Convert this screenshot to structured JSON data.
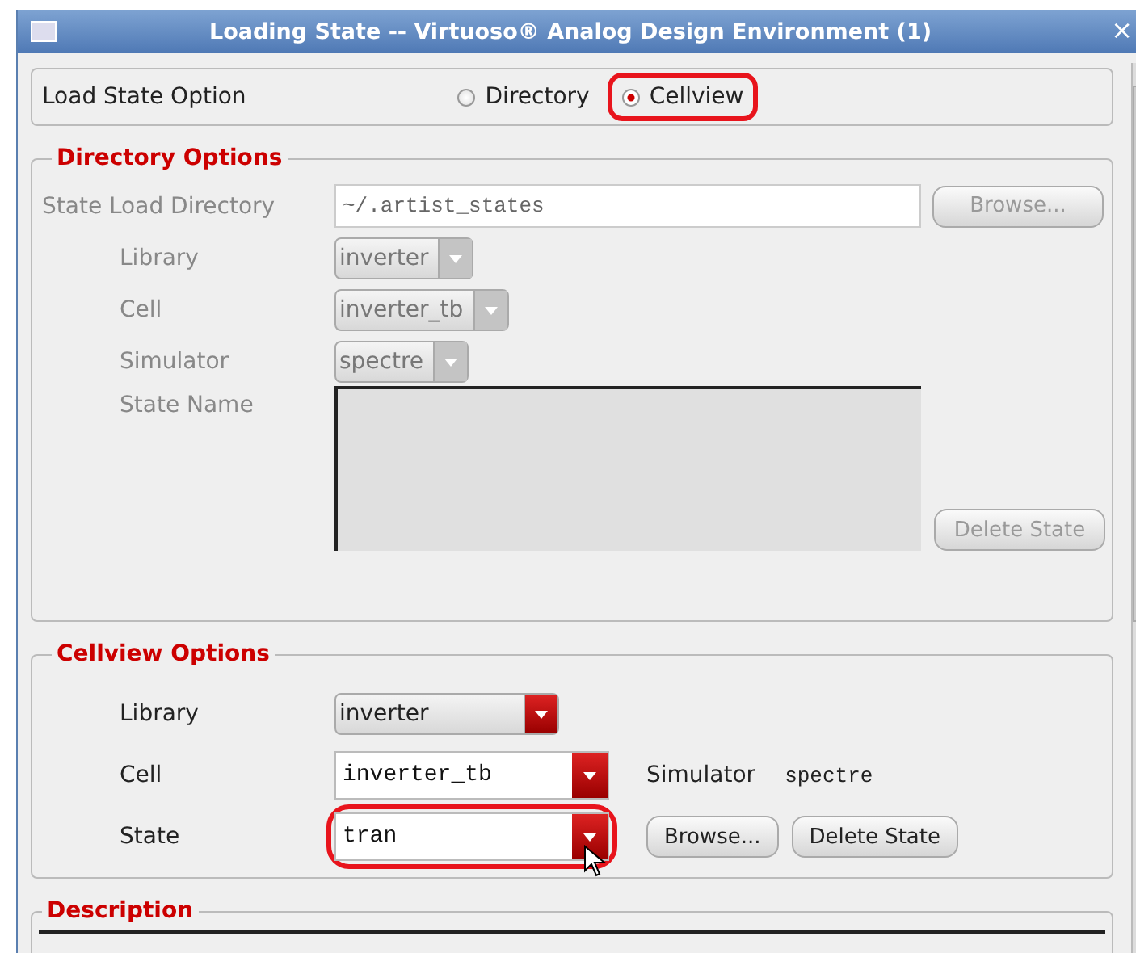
{
  "window": {
    "title": "Loading State -- Virtuoso® Analog Design Environment (1)",
    "close": "×"
  },
  "load_state_option": {
    "label": "Load State Option",
    "options": [
      {
        "label": "Directory",
        "selected": false,
        "highlighted": false
      },
      {
        "label": "Cellview",
        "selected": true,
        "highlighted": true
      }
    ]
  },
  "directory_options": {
    "title": "Directory Options",
    "disabled": true,
    "state_load_directory": {
      "label": "State Load Directory",
      "value": "~/.artist_states",
      "button": "Browse..."
    },
    "dropdowns": [
      {
        "label": "Library",
        "value": "inverter"
      },
      {
        "label": "Cell",
        "value": "inverter_tb"
      },
      {
        "label": "Simulator",
        "value": "spectre"
      }
    ],
    "state_name": {
      "label": "State Name"
    },
    "delete_button": "Delete State"
  },
  "cellview_options": {
    "title": "Cellview Options",
    "rows": [
      {
        "kind": "dropdown",
        "label": "Library",
        "value": "inverter",
        "highlighted": false
      },
      {
        "kind": "combo",
        "label": "Cell",
        "value": "inverter_tb",
        "highlighted": false,
        "extra_label": "Simulator",
        "extra_value": "spectre"
      },
      {
        "kind": "combo",
        "label": "State",
        "value": "tran",
        "highlighted": true,
        "buttons": [
          "Browse...",
          "Delete State"
        ]
      }
    ]
  },
  "description": {
    "title": "Description"
  }
}
